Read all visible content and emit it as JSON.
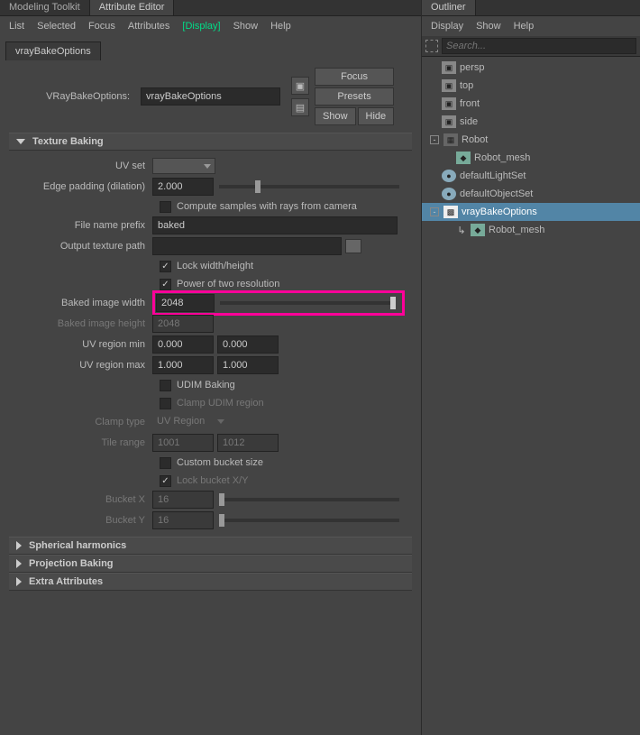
{
  "left": {
    "tabs": {
      "modeling": "Modeling Toolkit",
      "attr": "Attribute Editor"
    },
    "menu": {
      "list": "List",
      "selected": "Selected",
      "focus": "Focus",
      "attributes": "Attributes",
      "display": "Display",
      "show": "Show",
      "help": "Help"
    },
    "node_tab": "vrayBakeOptions",
    "top": {
      "label": "VRayBakeOptions:",
      "value": "vrayBakeOptions",
      "focus": "Focus",
      "presets": "Presets",
      "show": "Show",
      "hide": "Hide"
    },
    "sections": {
      "texture_baking": "Texture Baking",
      "spherical": "Spherical harmonics",
      "projection": "Projection Baking",
      "extra": "Extra Attributes"
    },
    "fields": {
      "uv_set": "UV set",
      "edge_padding": "Edge padding (dilation)",
      "edge_padding_val": "2.000",
      "compute_samples": "Compute samples with rays from camera",
      "filename_prefix": "File name prefix",
      "filename_val": "baked",
      "output_path": "Output texture path",
      "lock_wh": "Lock width/height",
      "power2": "Power of two resolution",
      "baked_w": "Baked image width",
      "baked_w_val": "2048",
      "baked_h": "Baked image height",
      "baked_h_val": "2048",
      "uv_min": "UV region min",
      "uv_min_x": "0.000",
      "uv_min_y": "0.000",
      "uv_max": "UV region max",
      "uv_max_x": "1.000",
      "uv_max_y": "1.000",
      "udim": "UDIM Baking",
      "clamp_udim": "Clamp UDIM region",
      "clamp_type": "Clamp type",
      "clamp_type_val": "UV Region",
      "tile_range": "Tile range",
      "tile_a": "1001",
      "tile_b": "1012",
      "custom_bucket": "Custom bucket size",
      "lock_bucket": "Lock bucket X/Y",
      "bucket_x": "Bucket X",
      "bucket_x_val": "16",
      "bucket_y": "Bucket Y",
      "bucket_y_val": "16"
    }
  },
  "right": {
    "title": "Outliner",
    "menu": {
      "display": "Display",
      "show": "Show",
      "help": "Help"
    },
    "search_placeholder": "Search...",
    "tree": {
      "persp": "persp",
      "top": "top",
      "front": "front",
      "side": "side",
      "robot": "Robot",
      "robot_mesh": "Robot_mesh",
      "default_light": "defaultLightSet",
      "default_obj": "defaultObjectSet",
      "vray": "vrayBakeOptions",
      "vray_child": "Robot_mesh"
    }
  }
}
